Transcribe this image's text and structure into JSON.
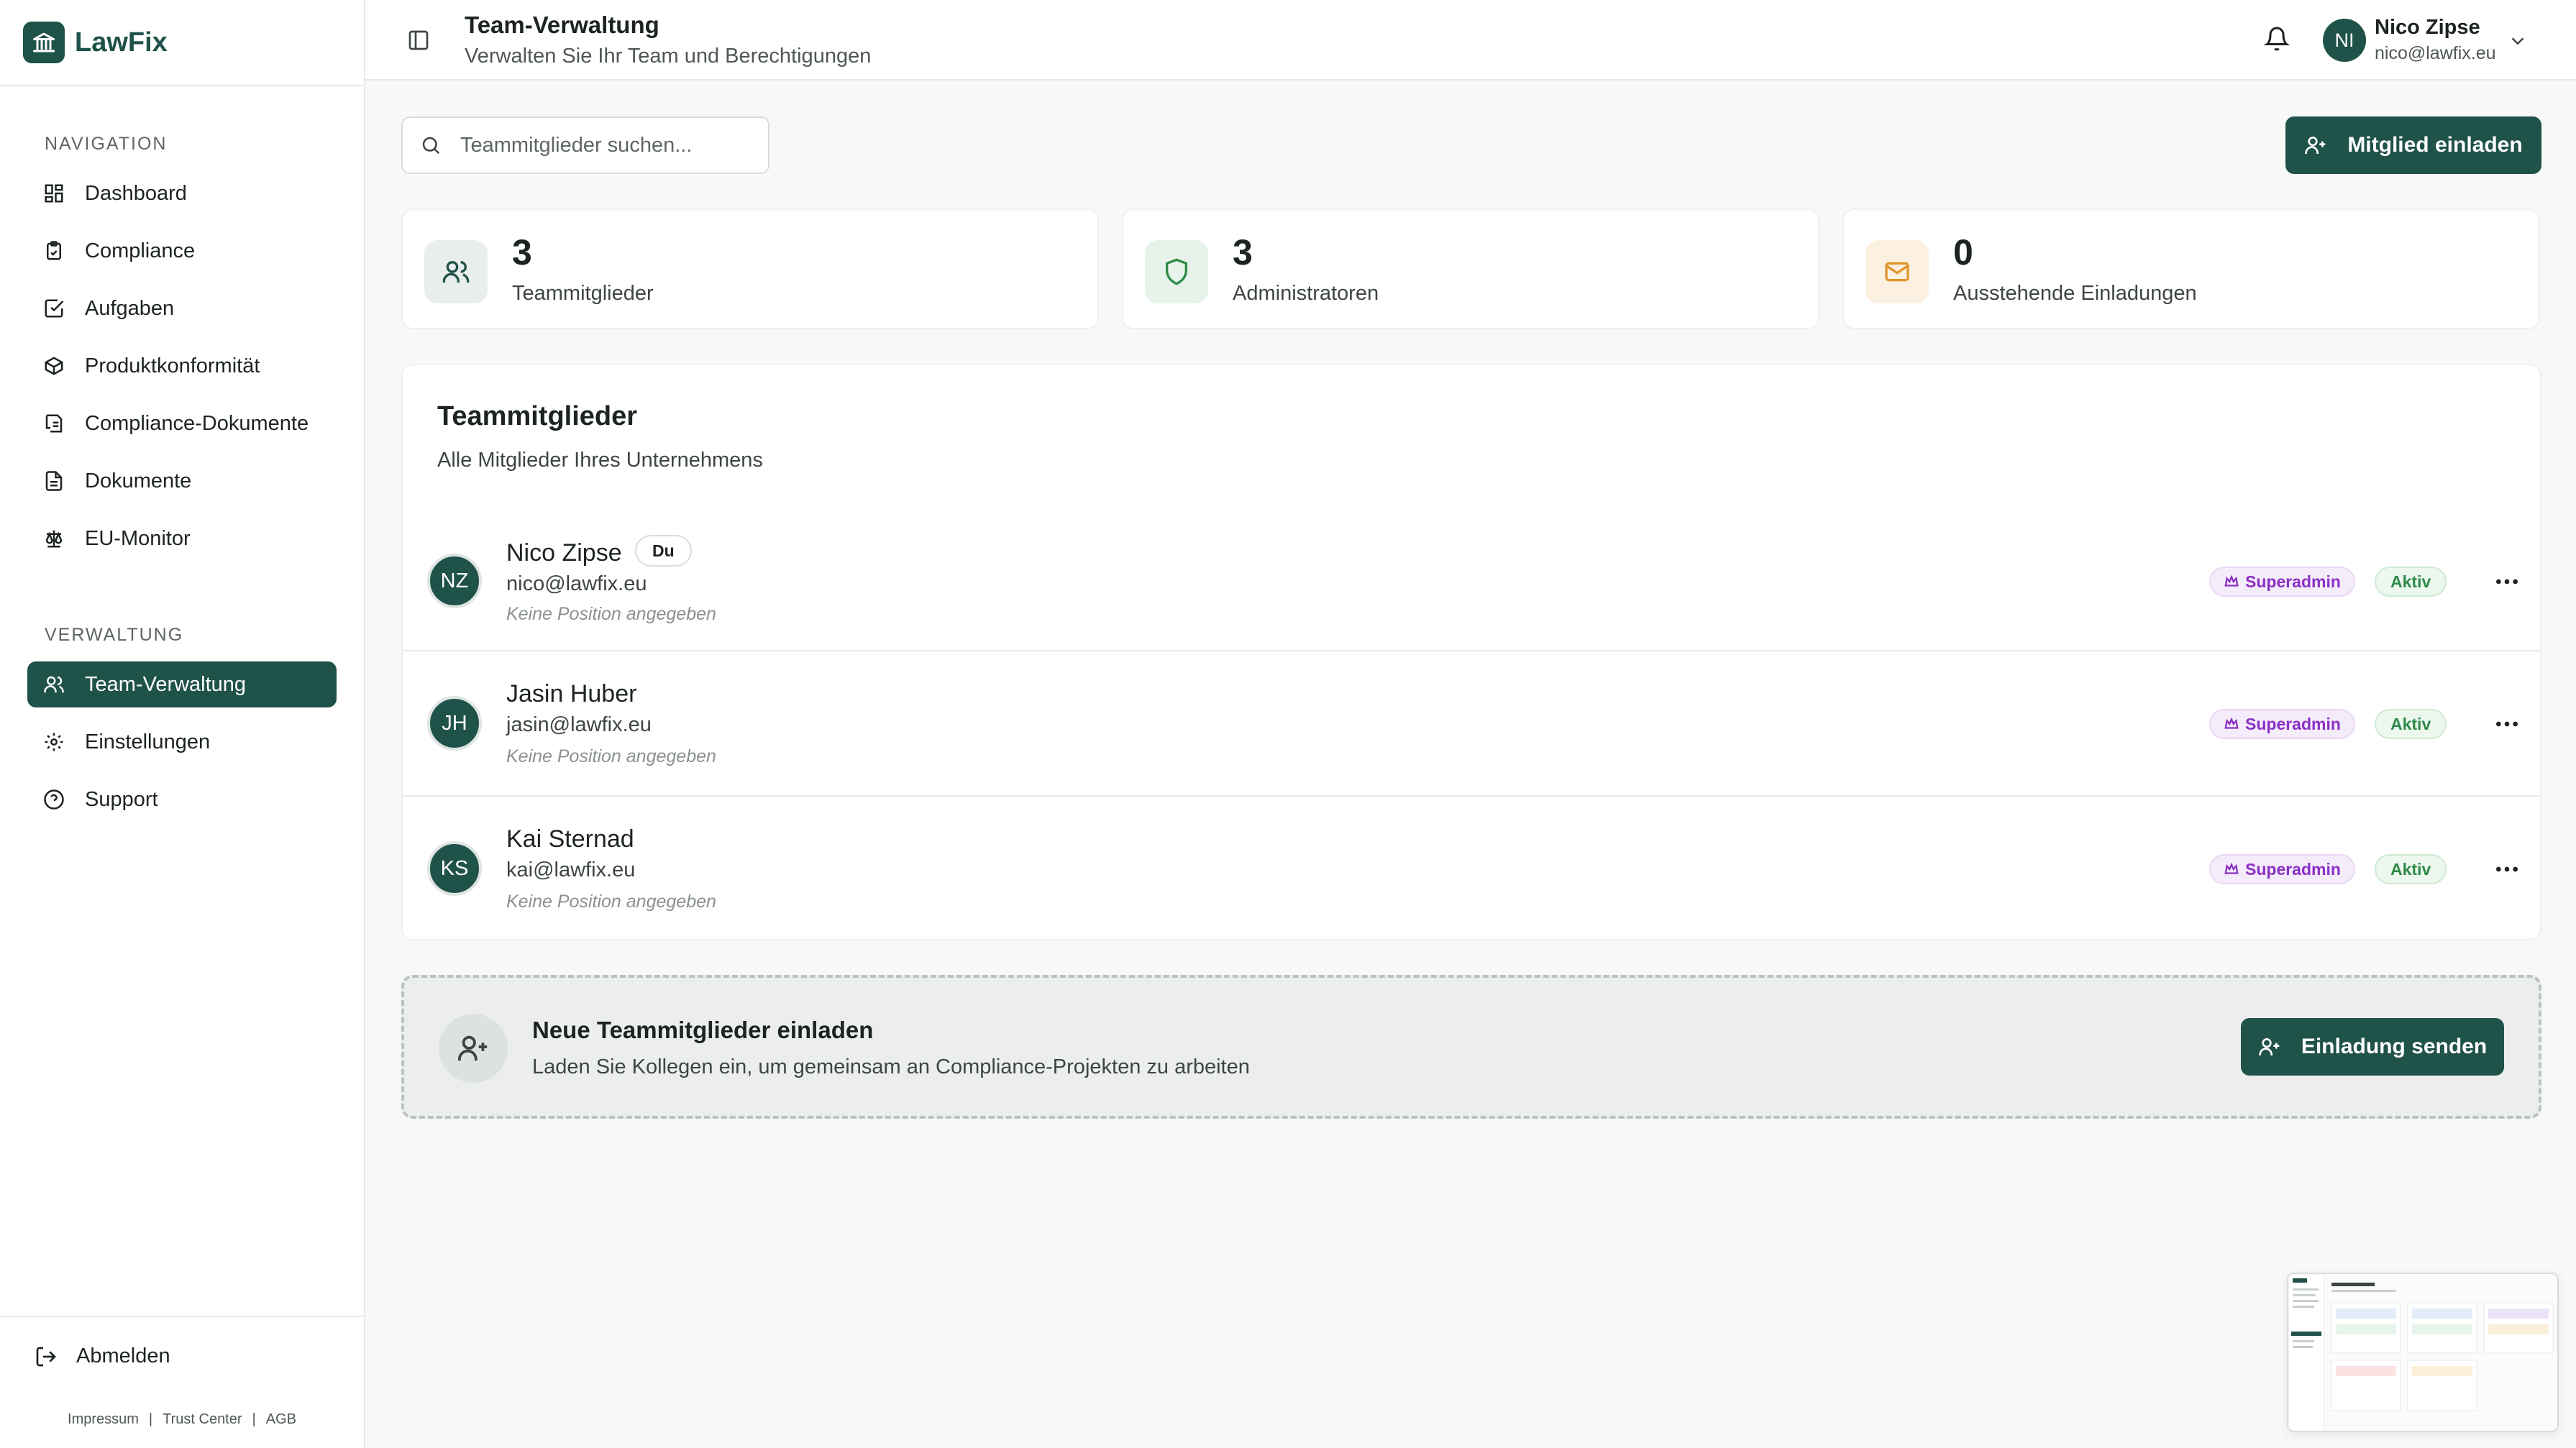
{
  "brand": {
    "name": "LawFix"
  },
  "sidebar": {
    "nav_heading": "NAVIGATION",
    "nav_items": [
      {
        "label": "Dashboard",
        "icon": "dashboard-icon"
      },
      {
        "label": "Compliance",
        "icon": "clipboard-icon"
      },
      {
        "label": "Aufgaben",
        "icon": "checkbox-icon"
      },
      {
        "label": "Produktkonformität",
        "icon": "package-icon"
      },
      {
        "label": "Compliance-Dokumente",
        "icon": "document-stack-icon"
      },
      {
        "label": "Dokumente",
        "icon": "file-icon"
      },
      {
        "label": "EU-Monitor",
        "icon": "scale-icon"
      }
    ],
    "admin_heading": "VERWALTUNG",
    "admin_items": [
      {
        "label": "Team-Verwaltung",
        "icon": "users-icon",
        "active": true
      },
      {
        "label": "Einstellungen",
        "icon": "gear-icon"
      },
      {
        "label": "Support",
        "icon": "help-circle-icon"
      }
    ],
    "logout_label": "Abmelden",
    "legal": {
      "impressum": "Impressum",
      "trust_center": "Trust Center",
      "agb": "AGB"
    }
  },
  "header": {
    "title": "Team-Verwaltung",
    "subtitle": "Verwalten Sie Ihr Team und Berechtigungen",
    "user": {
      "initials": "NI",
      "name": "Nico Zipse",
      "email": "nico@lawfix.eu"
    }
  },
  "toolbar": {
    "search_placeholder": "Teammitglieder suchen...",
    "invite_label": "Mitglied einladen"
  },
  "stats": [
    {
      "value": "3",
      "label": "Teammitglieder",
      "icon": "users-icon"
    },
    {
      "value": "3",
      "label": "Administratoren",
      "icon": "shield-icon"
    },
    {
      "value": "0",
      "label": "Ausstehende Einladungen",
      "icon": "mail-icon"
    }
  ],
  "members_card": {
    "title": "Teammitglieder",
    "subtitle": "Alle Mitglieder Ihres Unternehmens",
    "members": [
      {
        "initials": "NZ",
        "name": "Nico Zipse",
        "you_badge": "Du",
        "email": "nico@lawfix.eu",
        "position": "Keine Position angegeben",
        "role": "Superadmin",
        "status": "Aktiv"
      },
      {
        "initials": "JH",
        "name": "Jasin Huber",
        "email": "jasin@lawfix.eu",
        "position": "Keine Position angegeben",
        "role": "Superadmin",
        "status": "Aktiv"
      },
      {
        "initials": "KS",
        "name": "Kai Sternad",
        "email": "kai@lawfix.eu",
        "position": "Keine Position angegeben",
        "role": "Superadmin",
        "status": "Aktiv"
      }
    ]
  },
  "invite_box": {
    "title": "Neue Teammitglieder einladen",
    "subtitle": "Laden Sie Kollegen ein, um gemeinsam an Compliance-Projekten zu arbeiten",
    "button_label": "Einladung senden"
  },
  "colors": {
    "primary": "#1f5249",
    "superadmin": "#8a2fc4",
    "active": "#2e8a48",
    "warning": "#e0962e"
  }
}
